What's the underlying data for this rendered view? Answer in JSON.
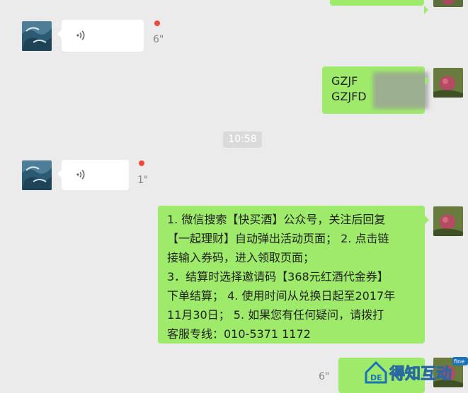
{
  "messages": {
    "voice1": {
      "duration": "6\""
    },
    "gz": {
      "line1": "GZJF",
      "line2": "GZJFD"
    },
    "timestamp": "10:58",
    "voice2": {
      "duration": "1\""
    },
    "instructions": {
      "lines": [
        "1. 微信搜索【快买酒】公众号，关注后回复",
        "【一起理财】自动弹出活动页面； 2. 点击链",
        "接输入券码，进入领取页面；",
        "3．结算时选择邀请码【368元红酒代金券】",
        "下单结算； 4. 使用时间从兑换日起至2017年",
        "11月30日； 5. 如果您有任何疑问，请拨打",
        "客服专线：010-5371 1172"
      ]
    },
    "voice3": {
      "duration": "6\""
    }
  },
  "watermark": {
    "text": "得知互动",
    "badge": "fine"
  },
  "colors": {
    "background": "#ebebeb",
    "bubble_green": "#9eea6a",
    "bubble_white": "#ffffff",
    "unread": "#f04a3e"
  }
}
